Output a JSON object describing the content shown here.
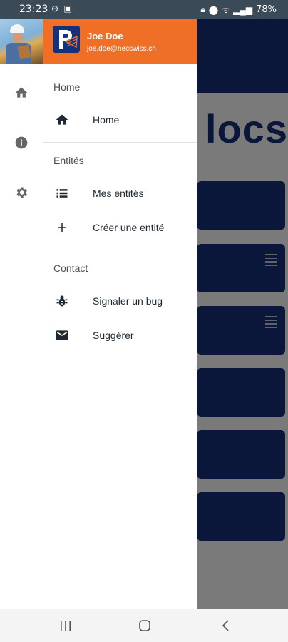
{
  "status_bar": {
    "time": "23:23",
    "battery": "78%",
    "left_icons": [
      "do-not-disturb-icon",
      "message-icon"
    ],
    "right_icons": [
      "lock-icon",
      "location-icon",
      "wifi-icon",
      "signal-icon"
    ]
  },
  "drawer": {
    "user": {
      "name": "Joe Doe",
      "email": "joe.doe@necswiss.ch"
    },
    "header_color": "#f06f27",
    "logo_color": "#17307a",
    "sections": [
      {
        "title": "Home",
        "items": [
          {
            "label": "Home",
            "icon": "home-icon"
          }
        ]
      },
      {
        "title": "Entités",
        "items": [
          {
            "label": "Mes entités",
            "icon": "list-icon"
          },
          {
            "label": "Créer une entité",
            "icon": "plus-icon"
          }
        ]
      },
      {
        "title": "Contact",
        "items": [
          {
            "label": "Signaler un bug",
            "icon": "bug-icon"
          },
          {
            "label": "Suggérer",
            "icon": "mail-icon"
          }
        ]
      }
    ]
  },
  "rail": {
    "icons": [
      "home-icon",
      "info-icon",
      "settings-icon"
    ]
  },
  "background": {
    "title_fragment": "locs",
    "brand_color": "#17307a"
  },
  "navigation_bar": {
    "buttons": [
      "recents-button",
      "home-button",
      "back-button"
    ]
  }
}
